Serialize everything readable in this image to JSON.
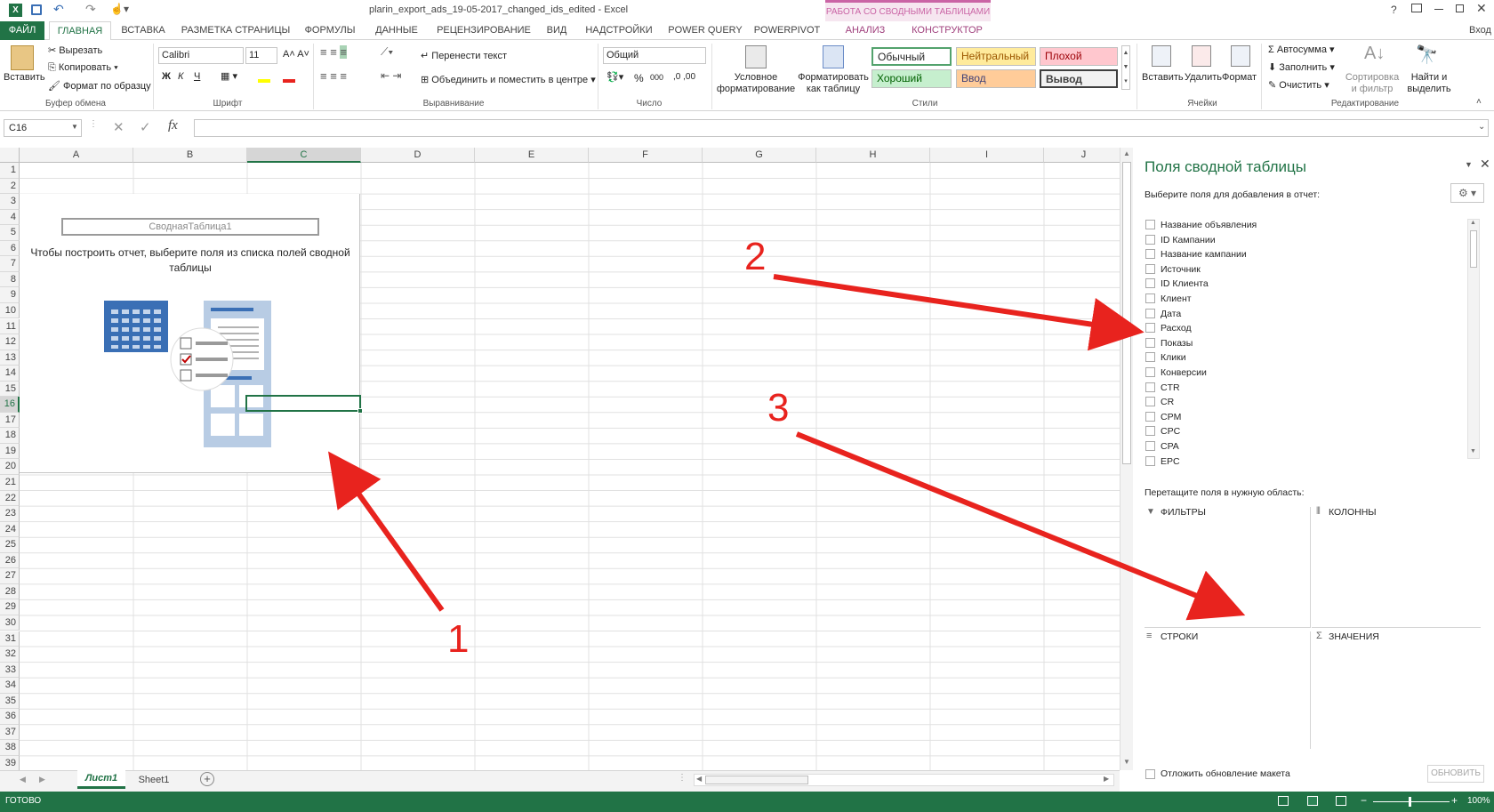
{
  "window": {
    "title": "plarin_export_ads_19-05-2017_changed_ids_edited - Excel",
    "context_tab_group": "РАБОТА СО СВОДНЫМИ ТАБЛИЦАМИ",
    "login": "Вход",
    "help": "?"
  },
  "tabs": [
    {
      "label": "ФАЙЛ"
    },
    {
      "label": "ГЛАВНАЯ"
    },
    {
      "label": "ВСТАВКА"
    },
    {
      "label": "РАЗМЕТКА СТРАНИЦЫ"
    },
    {
      "label": "ФОРМУЛЫ"
    },
    {
      "label": "ДАННЫЕ"
    },
    {
      "label": "РЕЦЕНЗИРОВАНИЕ"
    },
    {
      "label": "ВИД"
    },
    {
      "label": "НАДСТРОЙКИ"
    },
    {
      "label": "POWER QUERY"
    },
    {
      "label": "POWERPIVOT"
    },
    {
      "label": "АНАЛИЗ"
    },
    {
      "label": "КОНСТРУКТОР"
    }
  ],
  "ribbon": {
    "clipboard": {
      "paste": "Вставить",
      "cut": "Вырезать",
      "copy": "Копировать",
      "format_painter": "Формат по образцу",
      "label": "Буфер обмена"
    },
    "font": {
      "name": "Calibri",
      "size": "11",
      "bold": "Ж",
      "italic": "К",
      "underline": "Ч",
      "label": "Шрифт"
    },
    "alignment": {
      "wrap": "Перенести текст",
      "merge": "Объединить и поместить в центре",
      "label": "Выравнивание"
    },
    "number": {
      "format": "Общий",
      "percent": "%",
      "thousands": "000",
      "label": "Число"
    },
    "styles": {
      "conditional": "Условное форматирование",
      "as_table": "Форматировать как таблицу",
      "normal": "Обычный",
      "neutral": "Нейтральный",
      "bad": "Плохой",
      "good": "Хороший",
      "input": "Ввод",
      "output": "Вывод",
      "label": "Стили"
    },
    "cells": {
      "insert": "Вставить",
      "delete": "Удалить",
      "format": "Формат",
      "label": "Ячейки"
    },
    "editing": {
      "autosum": "Автосумма",
      "fill": "Заполнить",
      "clear": "Очистить",
      "sort": "Сортировка и фильтр",
      "find": "Найти и выделить",
      "label": "Редактирование"
    }
  },
  "formula_bar": {
    "name_box": "C16",
    "fx": "fx",
    "value": ""
  },
  "grid": {
    "columns": [
      "A",
      "B",
      "C",
      "D",
      "E",
      "F",
      "G",
      "H",
      "I",
      "J"
    ],
    "rows": [
      "1",
      "2",
      "3",
      "4",
      "5",
      "6",
      "7",
      "8",
      "9",
      "10",
      "11",
      "12",
      "13",
      "14",
      "15",
      "16",
      "17",
      "18",
      "19",
      "20",
      "21",
      "22",
      "23",
      "24",
      "25",
      "26",
      "27",
      "28",
      "29",
      "30",
      "31",
      "32",
      "33",
      "34",
      "35",
      "36",
      "37",
      "38",
      "39"
    ],
    "pivot_name": "СводнаяТаблица1",
    "pivot_hint": "Чтобы построить отчет, выберите поля из списка полей сводной таблицы"
  },
  "pivot_panel": {
    "title": "Поля сводной таблицы",
    "subtitle": "Выберите поля для добавления в отчет:",
    "fields": [
      "Название объявления",
      "ID Кампании",
      "Название кампании",
      "Источник",
      "ID Клиента",
      "Клиент",
      "Дата",
      "Расход",
      "Показы",
      "Клики",
      "Конверсии",
      "CTR",
      "CR",
      "CPM",
      "CPC",
      "CPA",
      "EPC"
    ],
    "drag_label": "Перетащите поля в нужную область:",
    "areas": {
      "filters": "ФИЛЬТРЫ",
      "columns": "КОЛОННЫ",
      "rows": "СТРОКИ",
      "values": "ЗНАЧЕНИЯ"
    },
    "defer_label": "Отложить обновление макета",
    "update_button": "ОБНОВИТЬ"
  },
  "sheets": [
    {
      "name": "Лист1"
    },
    {
      "name": "Sheet1"
    }
  ],
  "status": {
    "ready": "ГОТОВО",
    "zoom": "100%"
  },
  "annotations": [
    "1",
    "2",
    "3"
  ],
  "colors": {
    "excel_green": "#217346",
    "accent_arrow": "#e8231e",
    "context_tab": "#ca64a5"
  }
}
